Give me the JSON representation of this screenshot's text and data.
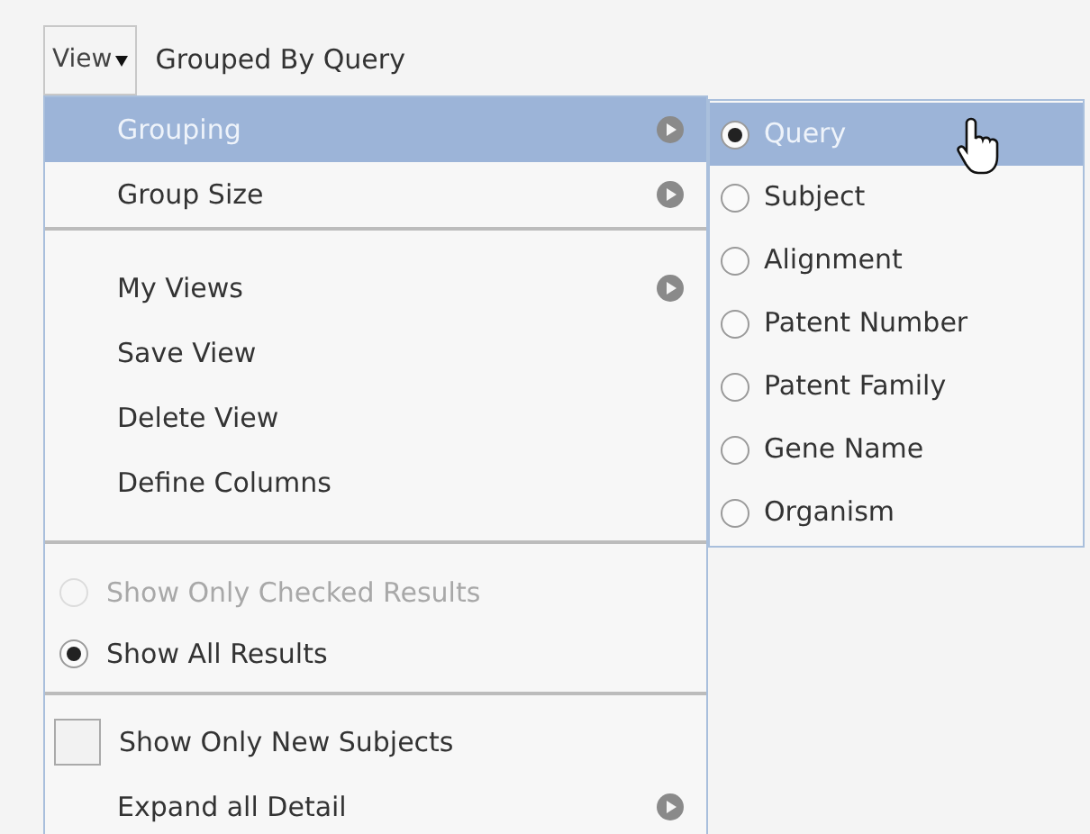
{
  "view_button": {
    "label": "View"
  },
  "grouping_status": "Grouped By Query",
  "menu": {
    "sections": [
      {
        "items": [
          {
            "kind": "action",
            "label": "Grouping",
            "submenu": true,
            "highlighted": true
          },
          {
            "kind": "action",
            "label": "Group Size",
            "submenu": true,
            "highlighted": false
          }
        ]
      },
      {
        "items": [
          {
            "kind": "action",
            "label": "My Views",
            "submenu": true,
            "highlighted": false
          },
          {
            "kind": "action",
            "label": "Save View",
            "submenu": false,
            "highlighted": false
          },
          {
            "kind": "action",
            "label": "Delete View",
            "submenu": false,
            "highlighted": false
          },
          {
            "kind": "action",
            "label": "Define Columns",
            "submenu": false,
            "highlighted": false
          }
        ]
      },
      {
        "items": [
          {
            "kind": "radio",
            "label": "Show Only Checked Results",
            "selected": false,
            "disabled": true
          },
          {
            "kind": "radio",
            "label": "Show All Results",
            "selected": true,
            "disabled": false
          }
        ]
      },
      {
        "items": [
          {
            "kind": "checkbox",
            "label": "Show Only New Subjects",
            "checked": false
          },
          {
            "kind": "action",
            "label": "Expand all Detail",
            "submenu": true,
            "highlighted": false
          }
        ]
      }
    ]
  },
  "submenu": {
    "items": [
      {
        "label": "Query",
        "selected": true,
        "highlighted": true
      },
      {
        "label": "Subject",
        "selected": false,
        "highlighted": false
      },
      {
        "label": "Alignment",
        "selected": false,
        "highlighted": false
      },
      {
        "label": "Patent Number",
        "selected": false,
        "highlighted": false
      },
      {
        "label": "Patent Family",
        "selected": false,
        "highlighted": false
      },
      {
        "label": "Gene Name",
        "selected": false,
        "highlighted": false
      },
      {
        "label": "Organism",
        "selected": false,
        "highlighted": false
      }
    ]
  }
}
